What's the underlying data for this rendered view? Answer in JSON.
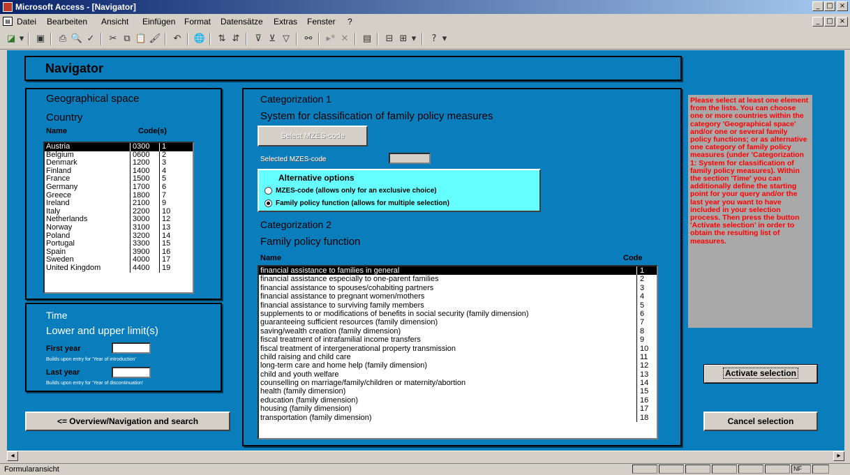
{
  "window": {
    "title": "Microsoft Access - [Navigator]",
    "min": "_",
    "max": "□",
    "close": "×"
  },
  "menu": [
    "Datei",
    "Bearbeiten",
    "Ansicht",
    "Einfügen",
    "Format",
    "Datensätze",
    "Extras",
    "Fenster",
    "?"
  ],
  "navigator_title": "Navigator",
  "geo": {
    "heading": "Geographical space",
    "country_label": "Country",
    "col_name": "Name",
    "col_code": "Code(s)",
    "countries": [
      [
        "Austria",
        "0300",
        "1"
      ],
      [
        "Belgium",
        "0600",
        "2"
      ],
      [
        "Denmark",
        "1200",
        "3"
      ],
      [
        "Finland",
        "1400",
        "4"
      ],
      [
        "France",
        "1500",
        "5"
      ],
      [
        "Germany",
        "1700",
        "6"
      ],
      [
        "Greece",
        "1800",
        "7"
      ],
      [
        "Ireland",
        "2100",
        "9"
      ],
      [
        "Italy",
        "2200",
        "10"
      ],
      [
        "Netherlands",
        "3000",
        "12"
      ],
      [
        "Norway",
        "3100",
        "13"
      ],
      [
        "Poland",
        "3200",
        "14"
      ],
      [
        "Portugal",
        "3300",
        "15"
      ],
      [
        "Spain",
        "3900",
        "16"
      ],
      [
        "Sweden",
        "4000",
        "17"
      ],
      [
        "United Kingdom",
        "4400",
        "19"
      ]
    ]
  },
  "time": {
    "heading": "Time",
    "subheading": "Lower and upper limit(s)",
    "first_year": "First year",
    "first_hint": "Builds upon entry for 'Year of introduction'",
    "last_year": "Last year",
    "last_hint": "Builds upon entry for 'Year of discontinuation'",
    "first_value": "",
    "last_value": ""
  },
  "overview_button": "<= Overview/Navigation and search",
  "cat1": {
    "heading": "Categorization 1",
    "subheading": "System for classification of family policy measures",
    "select_button": "Select MZES-code",
    "selected_label": "Selected MZES-code",
    "selected_value": ""
  },
  "alt": {
    "heading": "Alternative options",
    "opt1": "MZES-code (allows only for an exclusive choice)",
    "opt2": "Family policy function (allows for multiple selection)",
    "checked": 2
  },
  "cat2": {
    "heading": "Categorization 2",
    "subheading": "Family policy function",
    "col_name": "Name",
    "col_code": "Code",
    "functions": [
      [
        "financial assistance to families in general",
        "1"
      ],
      [
        "financial assistance especially to one-parent families",
        "2"
      ],
      [
        "financial assistance to spouses/cohabiting partners",
        "3"
      ],
      [
        "financial assistance to pregnant women/mothers",
        "4"
      ],
      [
        "financial assistance to surviving family members",
        "5"
      ],
      [
        "supplements to or modifications of benefits in social security (family dimension)",
        "6"
      ],
      [
        "guaranteeing sufficient resources (family dimension)",
        "7"
      ],
      [
        "saving/wealth creation (family dimension)",
        "8"
      ],
      [
        "fiscal treatment of intrafamilial income transfers",
        "9"
      ],
      [
        "fiscal treatment of intergenerational property transmission",
        "10"
      ],
      [
        "child raising and child care",
        "11"
      ],
      [
        "long-term care and home help (family dimension)",
        "12"
      ],
      [
        "child and youth welfare",
        "13"
      ],
      [
        "counselling on marriage/family/children or maternity/abortion",
        "14"
      ],
      [
        "health (family dimension)",
        "15"
      ],
      [
        "education (family dimension)",
        "16"
      ],
      [
        "housing (family dimension)",
        "17"
      ],
      [
        "transportation (family dimension)",
        "18"
      ]
    ]
  },
  "help_text": "Please select at least one element from the lists. You can choose one or more countries within the category 'Geographical space' and/or one or several family policy functions; or as alternative one category of family policy measures (under 'Categorization 1: System for classification of family policy measures). Within the section 'Time' you can additionally define the starting point for your query and/or the last year you want to have included in your selection process. Then press the button 'Activate selection' in order to obtain the resulting list of measures.",
  "activate_button": "Activate selection",
  "cancel_button": "Cancel selection",
  "status": {
    "left": "Formularansicht",
    "nf": "NF"
  },
  "colors": {
    "form_bg": "#0a7dbd",
    "help_bg": "#a9a9a9",
    "help_text": "#ff0000",
    "options_bg": "#66ffff"
  }
}
